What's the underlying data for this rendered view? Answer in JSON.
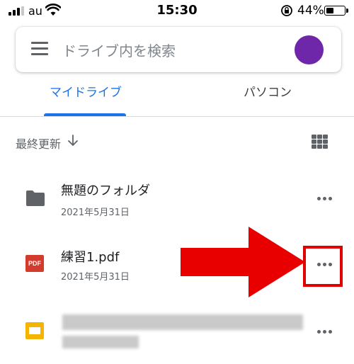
{
  "status_bar": {
    "carrier": "au",
    "time": "15:30",
    "battery_percent": "44%",
    "battery_level": 0.44,
    "icons": [
      "signal-icon",
      "wifi-icon",
      "rotation-lock-icon",
      "battery-icon"
    ]
  },
  "search": {
    "placeholder": "ドライブ内を検索",
    "menu_icon": "hamburger-menu-icon",
    "avatar_color": "#6f27a9"
  },
  "tabs": [
    {
      "label": "マイドライブ",
      "active": true
    },
    {
      "label": "パソコン",
      "active": false
    }
  ],
  "sort": {
    "label": "最終更新",
    "direction_icon": "arrow-down-icon",
    "view_icon": "grid-view-icon"
  },
  "files": [
    {
      "name": "無題のフォルダ",
      "date": "2021年5月31日",
      "type": "folder",
      "icon": "folder-icon"
    },
    {
      "name": "練習1.pdf",
      "date": "2021年5月31日",
      "type": "pdf",
      "icon": "pdf-icon",
      "icon_text": "PDF"
    },
    {
      "name": "",
      "date": "",
      "type": "slides",
      "icon": "slides-icon",
      "redacted": true
    }
  ],
  "colors": {
    "accent": "#1a73e8",
    "annotation_red": "#e00000",
    "folder_grey": "#5f6368",
    "pdf_red": "#d33b2c",
    "slides_yellow": "#f4b400"
  }
}
